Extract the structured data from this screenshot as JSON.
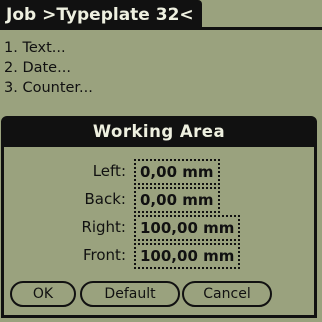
{
  "header": {
    "title": "Job >Typeplate 32<"
  },
  "menu": {
    "items": [
      {
        "label": "1. Text..."
      },
      {
        "label": "2. Date..."
      },
      {
        "label": "3. Counter..."
      }
    ]
  },
  "dialog": {
    "title": "Working Area",
    "fields": [
      {
        "label": "Left:",
        "value": "0,00 mm"
      },
      {
        "label": "Back:",
        "value": "0,00 mm"
      },
      {
        "label": "Right:",
        "value": "100,00 mm"
      },
      {
        "label": "Front:",
        "value": "100,00 mm"
      }
    ],
    "buttons": {
      "ok": "OK",
      "default": "Default",
      "cancel": "Cancel"
    }
  }
}
